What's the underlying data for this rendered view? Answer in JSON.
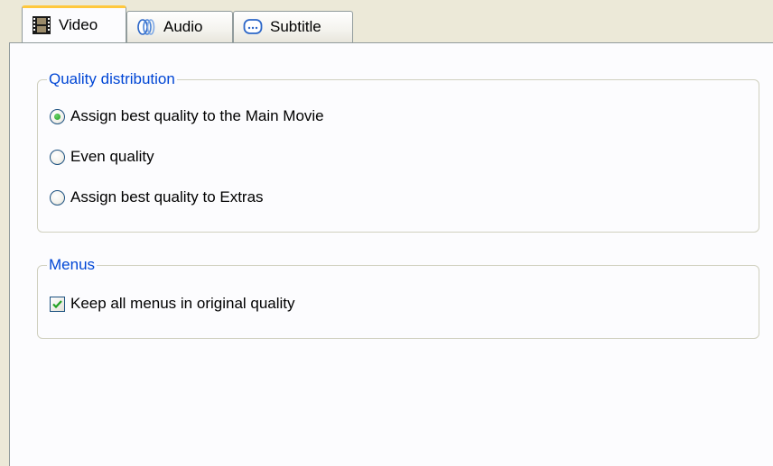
{
  "tabs": [
    {
      "label": "Video",
      "icon": "film-strip-icon",
      "active": true
    },
    {
      "label": "Audio",
      "icon": "speaker-wave-icon",
      "active": false
    },
    {
      "label": "Subtitle",
      "icon": "subtitle-bubble-icon",
      "active": false
    }
  ],
  "quality_group": {
    "legend": "Quality distribution",
    "options": [
      {
        "label": "Assign best quality to the Main Movie",
        "selected": true
      },
      {
        "label": "Even quality",
        "selected": false
      },
      {
        "label": "Assign best quality to Extras",
        "selected": false
      }
    ]
  },
  "menus_group": {
    "legend": "Menus",
    "keep_menus_label": "Keep all menus in original quality",
    "keep_menus_checked": true
  },
  "colors": {
    "accent_legend": "#0046d5",
    "active_tab_highlight": "#ffc83c",
    "radio_dot": "#21a121",
    "checkmark": "#21a121"
  }
}
